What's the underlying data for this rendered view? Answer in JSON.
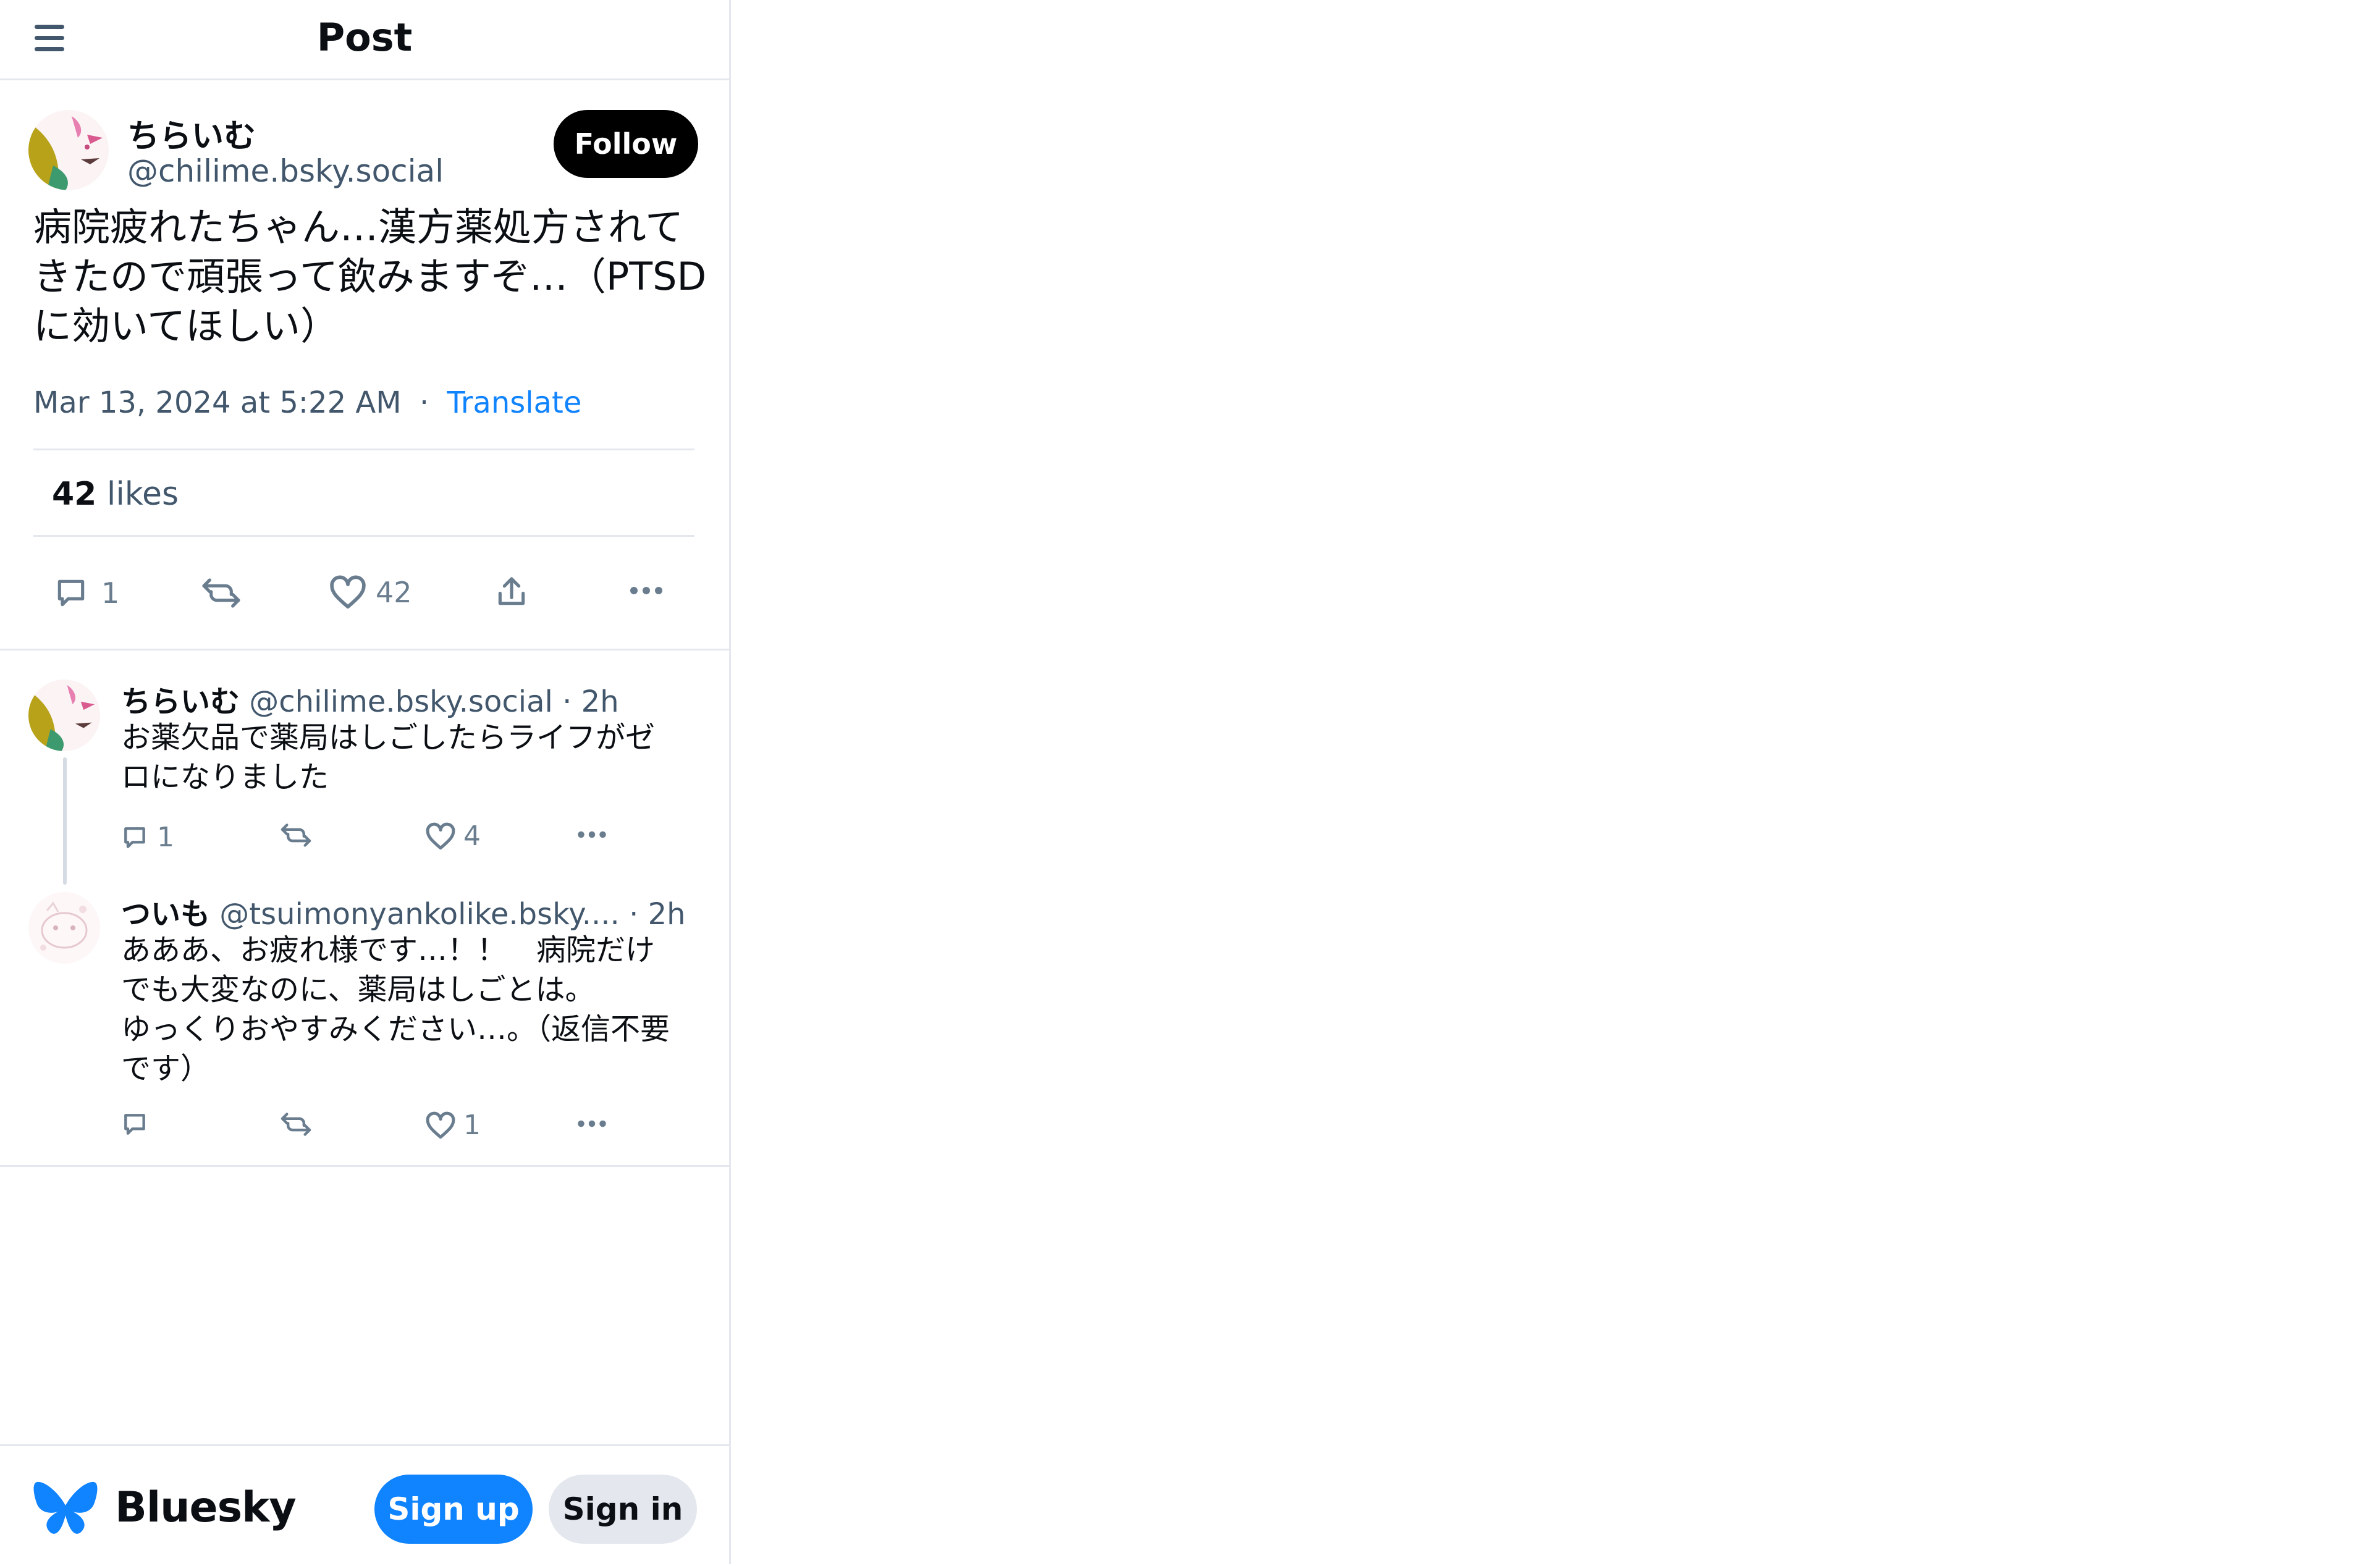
{
  "header": {
    "title": "Post",
    "menu_icon": "menu-icon"
  },
  "post": {
    "author_name": "ちらいむ",
    "author_handle": "@chilime.bsky.social",
    "follow_label": "Follow",
    "text": "病院疲れたちゃん…漢方薬処方されてきたので頑張って飲みますぞ…（PTSDに効いてほしい）",
    "timestamp": "Mar 13, 2024 at 5:22 AM",
    "separator": "·",
    "translate_label": "Translate",
    "likes_count": "42",
    "likes_label": "likes",
    "actions": {
      "reply_count": "1",
      "repost_count": "",
      "like_count": "42"
    }
  },
  "replies": [
    {
      "name": "ちらいむ",
      "handle": "@chilime.bsky.social",
      "time": "· 2h",
      "text": "お薬欠品で薬局はしごしたらライフがゼロになりました",
      "reply_count": "1",
      "like_count": "4"
    },
    {
      "name": "ついも",
      "handle": "@tsuimonyankolike.bsky....",
      "time": "· 2h",
      "text": "あああ、お疲れ様です…！！　病院だけでも大変なのに、薬局はしごとは。\nゆっくりおやすみください…。（返信不要です）",
      "reply_count": "",
      "like_count": "1"
    }
  ],
  "footer": {
    "brand": "Bluesky",
    "signup_label": "Sign up",
    "signin_label": "Sign in"
  },
  "colors": {
    "accent": "#1083fe",
    "text": "#0b0f14",
    "muted": "#42576c",
    "border": "#e4e8ee"
  }
}
